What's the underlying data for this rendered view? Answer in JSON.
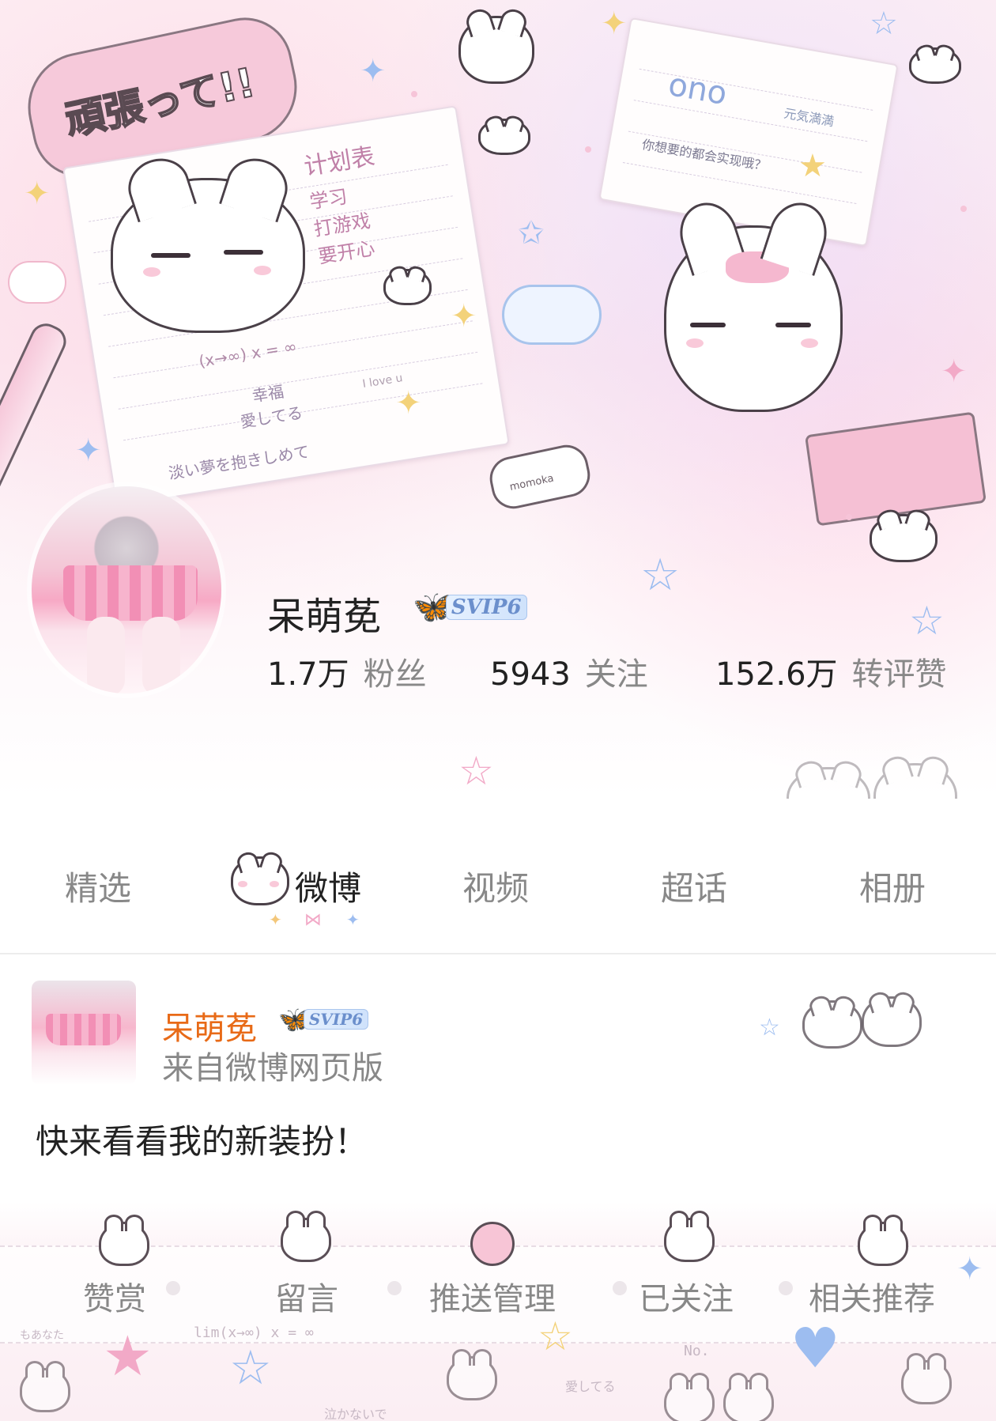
{
  "profile": {
    "name": "呆萌莬",
    "badge": "SVIP6",
    "stats": [
      {
        "value": "1.7万",
        "label": "粉丝"
      },
      {
        "value": "5943",
        "label": "关注"
      },
      {
        "value": "152.6万",
        "label": "转评赞"
      }
    ]
  },
  "banner": {
    "sticker_text": "頑張って!!",
    "planner_title": "计划表",
    "planner_items": [
      "学习",
      "打游戏",
      "要开心"
    ],
    "planner_formula": "(x→∞) x = ∞",
    "planner_note1": "幸福",
    "planner_note2": "愛してる",
    "planner_footer": "淡い夢を抱きしめて",
    "love_note": "I love u",
    "note_face": "ono",
    "note_tag": "元気満満",
    "note_question": "你想要的都会实现哦？",
    "eraser_label": "momoka"
  },
  "tabs": [
    "精选",
    "微博",
    "视频",
    "超话",
    "相册"
  ],
  "active_tab": 1,
  "post": {
    "author": "呆萌莬",
    "badge": "SVIP6",
    "source": "来自微博网页版",
    "text": "快来看看我的新装扮！"
  },
  "actions": [
    "赞赏",
    "留言",
    "推送管理",
    "已关注",
    "相关推荐"
  ],
  "footer_deco": {
    "formula": "lim(x→∞) x = ∞",
    "left": "もあなた",
    "no": "No.",
    "love": "愛してる",
    "bottom": "泣かないで"
  },
  "colors": {
    "author": "#e86a17",
    "active_tab": "#222222",
    "inactive": "#888888"
  }
}
